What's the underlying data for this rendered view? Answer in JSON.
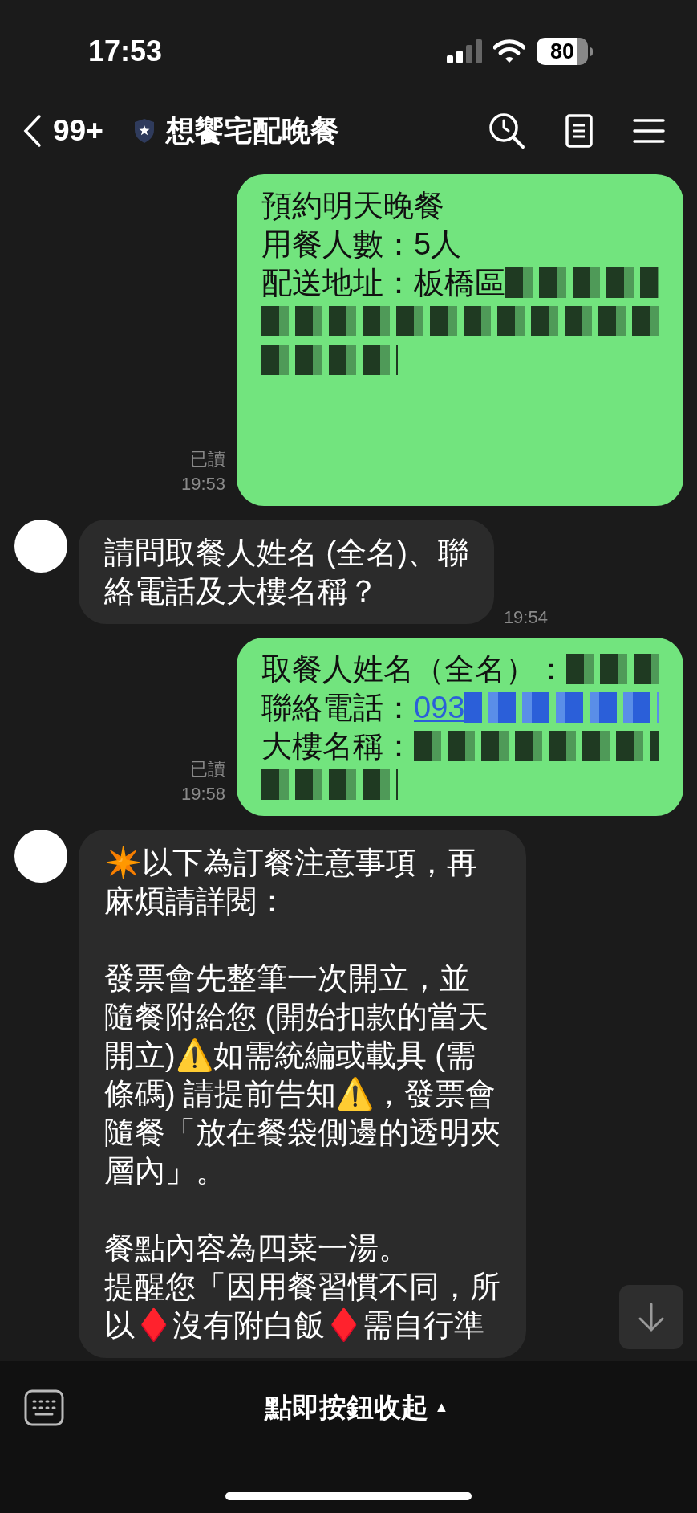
{
  "status_bar": {
    "time": "17:53",
    "battery": "80"
  },
  "header": {
    "back_count": "99+",
    "title": "想饗宅配晚餐"
  },
  "messages": [
    {
      "kind": "outgoing",
      "read": "已讀",
      "time": "19:53",
      "lines": [
        [
          {
            "kind": "text",
            "text": "預約明天晚餐"
          }
        ],
        [
          {
            "kind": "text",
            "text": "用餐人數：5人"
          }
        ],
        [
          {
            "kind": "text",
            "text": "配送地址：板橋區"
          },
          {
            "kind": "redacted"
          }
        ],
        [
          {
            "kind": "redacted"
          }
        ],
        [
          {
            "kind": "redacted-short"
          }
        ]
      ]
    },
    {
      "kind": "incoming",
      "time": "19:54",
      "blocks": [
        [
          "請問取餐人姓名 (全名)、聯",
          "絡電話及大樓名稱？"
        ]
      ]
    },
    {
      "kind": "outgoing",
      "read": "已讀",
      "time": "19:58",
      "lines": [
        [
          {
            "kind": "text",
            "text": "取餐人姓名（全名）："
          },
          {
            "kind": "redacted"
          }
        ],
        [
          {
            "kind": "text",
            "text": "聯絡電話："
          },
          {
            "kind": "link",
            "text": "093"
          },
          {
            "kind": "redacted-link"
          }
        ],
        [
          {
            "kind": "text",
            "text": "大樓名稱："
          },
          {
            "kind": "redacted"
          }
        ],
        [
          {
            "kind": "redacted-short"
          }
        ]
      ]
    },
    {
      "kind": "incoming",
      "blocks": [
        [
          "✴️以下為訂餐注意事項，再",
          "麻煩請詳閱："
        ],
        [
          "發票會先整筆一次開立，並",
          "隨餐附給您 (開始扣款的當天",
          "開立)⚠️如需統編或載具 (需",
          "條碼) 請提前告知⚠️，發票會",
          "隨餐「放在餐袋側邊的透明夾",
          "層內」。"
        ],
        [
          "餐點內容為四菜一湯。",
          "提醒您「因用餐習慣不同，所",
          "以♦️沒有附白飯♦️需自行準"
        ]
      ]
    }
  ],
  "bottom_bar": {
    "label": "點即按鈕收起",
    "caret": "▲"
  }
}
